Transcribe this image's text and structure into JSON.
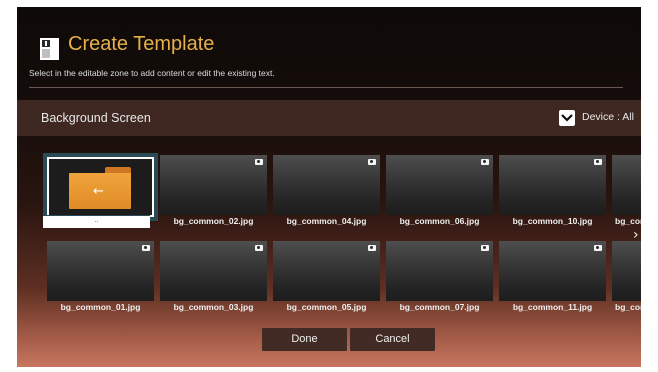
{
  "header": {
    "title": "Create Template",
    "subtitle": "Select in the editable zone to add content or edit the existing text."
  },
  "section": {
    "title": "Background Screen",
    "device_label": "Device : All"
  },
  "folder_tile": {
    "caption": ".."
  },
  "row1": [
    {
      "label": "bg_common_02.jpg"
    },
    {
      "label": "bg_common_04.jpg"
    },
    {
      "label": "bg_common_06.jpg"
    },
    {
      "label": "bg_common_10.jpg"
    },
    {
      "label": "bg_com"
    }
  ],
  "row2": [
    {
      "label": "bg_common_01.jpg"
    },
    {
      "label": "bg_common_03.jpg"
    },
    {
      "label": "bg_common_05.jpg"
    },
    {
      "label": "bg_common_07.jpg"
    },
    {
      "label": "bg_common_11.jpg"
    },
    {
      "label": "bg_com"
    }
  ],
  "buttons": {
    "done": "Done",
    "cancel": "Cancel"
  },
  "icons": [
    "template-icon",
    "checkbox-icon",
    "folder-up-icon",
    "camera-icon",
    "chevron-right-icon"
  ],
  "colors": {
    "accent": "#e6b04a",
    "selection": "#2a4b55"
  }
}
